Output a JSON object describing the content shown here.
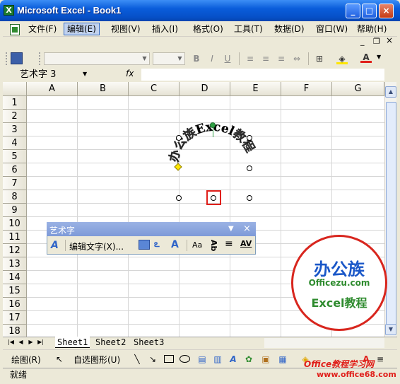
{
  "window": {
    "title": "Microsoft Excel - Book1",
    "app_icon": "X",
    "minimize": "_",
    "maximize": "□",
    "close": "×"
  },
  "menubar": {
    "items": [
      "文件(F)",
      "编辑(E)",
      "视图(V)",
      "插入(I)",
      "格式(O)",
      "工具(T)",
      "数据(D)",
      "窗口(W)",
      "帮助(H)"
    ],
    "doc_minimize": "_",
    "doc_restore": "❐",
    "doc_close": "×"
  },
  "formula_bar": {
    "name_box": "艺术字 3",
    "fx": "fx"
  },
  "grid": {
    "columns": [
      "A",
      "B",
      "C",
      "D",
      "E",
      "F",
      "G"
    ],
    "rows": [
      "1",
      "2",
      "3",
      "4",
      "5",
      "6",
      "7",
      "8",
      "9",
      "10",
      "11",
      "12",
      "13",
      "14",
      "15",
      "16",
      "17",
      "18"
    ]
  },
  "wordart": {
    "text": "办公族Excel教程"
  },
  "wordart_toolbar": {
    "title": "艺术字",
    "edit_text": "编辑文字(X)...",
    "aa": "Aa",
    "ab": "Ab",
    "av": "AV"
  },
  "sheet_tabs": [
    "Sheet1",
    "Sheet2",
    "Sheet3"
  ],
  "draw_toolbar": {
    "draw": "绘图(R)",
    "autoshapes": "自选图形(U)"
  },
  "status": {
    "text": "就绪"
  },
  "logo": {
    "top": "办公族",
    "middle": "Officezu.com",
    "bottom": "Excel教程"
  },
  "watermark": "Office教程学习网",
  "watermark_url": "www.office68.com",
  "colors": {
    "title_bar": "#0a5ddb",
    "wordart_handle_green": "#2ea043",
    "selection_red": "#e0201b",
    "logo_red": "#d8261e",
    "logo_blue": "#1a57c8",
    "logo_green": "#2e8b2e"
  }
}
